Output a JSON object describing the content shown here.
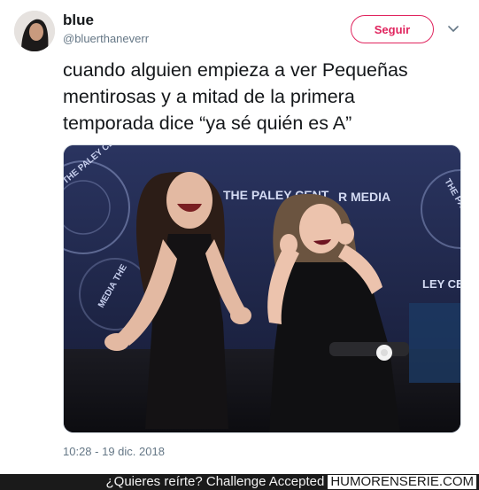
{
  "tweet": {
    "display_name": "blue",
    "handle": "@bluerthaneverr",
    "follow_label": "Seguir",
    "text": "cuando alguien empieza a ver Pequeñas\nmentirosas y a mitad de la primera\ntemporada dice  “ya sé quién es A”",
    "timestamp": "10:28 - 19 dic. 2018",
    "media": {
      "backdrop_text_left": "THE PALEY CENTER FOR MEDIA",
      "backdrop_text_mid": "THE PALEY CENT",
      "backdrop_text_mid2": "R MEDIA",
      "backdrop_text_right": "THE PALEY CENTER FOR MEDIA",
      "backdrop_text_bottom_left": "MEDIA THE",
      "backdrop_text_bottom_right": "LEY CE"
    }
  },
  "watermark": {
    "tagline": "¿Quieres reírte? Challenge Accepted",
    "site": "HUMORENSERIE.COM"
  },
  "colors": {
    "follow_accent": "#e0245e",
    "text_primary": "#14171a",
    "text_secondary": "#657786"
  },
  "icons": {
    "chevron": "chevron-down-icon"
  }
}
